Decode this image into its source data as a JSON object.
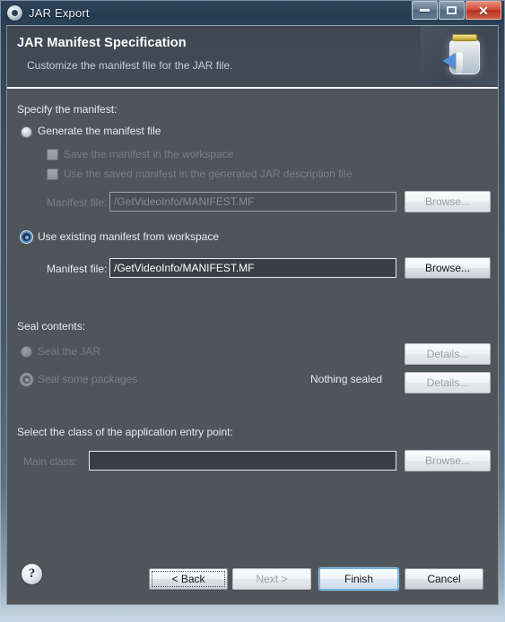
{
  "window": {
    "title": "JAR Export",
    "icon": "gear-icon",
    "controls": {
      "minimize": "minimize-icon",
      "maximize": "maximize-icon",
      "close": "✕"
    }
  },
  "header": {
    "title": "JAR Manifest Specification",
    "subtitle": "Customize the manifest file for the JAR file.",
    "art_icon": "jar-export-icon"
  },
  "content": {
    "manifest_section_label": "Specify the manifest:",
    "generate_radio": {
      "label": "Generate the manifest file",
      "selected": false
    },
    "save_checkbox": {
      "label": "Save the manifest in the workspace",
      "checked": false,
      "enabled": false
    },
    "use_saved_checkbox": {
      "label": "Use the saved manifest in the generated JAR description file",
      "checked": false,
      "enabled": false
    },
    "manifest_file_disabled": {
      "label": "Manifest file:",
      "value": "/GetVideoInfo/MANIFEST.MF",
      "browse_label": "Browse...",
      "enabled": false
    },
    "use_existing_radio": {
      "label": "Use existing manifest from workspace",
      "selected": true
    },
    "manifest_file_enabled": {
      "label": "Manifest file:",
      "value": "/GetVideoInfo/MANIFEST.MF",
      "browse_label": "Browse...",
      "enabled": true
    },
    "seal_section_label": "Seal contents:",
    "seal_jar_radio": {
      "label": "Seal the JAR",
      "selected": false,
      "details_label": "Details..."
    },
    "seal_packages_radio": {
      "label": "Seal some packages",
      "selected": true,
      "status": "Nothing sealed",
      "details_label": "Details..."
    },
    "entry_point_label": "Select the class of the application entry point:",
    "main_class": {
      "label": "Main class:",
      "value": "",
      "placeholder": "",
      "browse_label": "Browse..."
    }
  },
  "buttons": {
    "help": "?",
    "back": "< Back",
    "next": "Next >",
    "finish": "Finish",
    "cancel": "Cancel"
  },
  "colors": {
    "body_bg": "#50555a",
    "header_bg": "#414a54",
    "titlebar_bg": "#2b3f55",
    "accent_blue": "#3f8fd2",
    "close_red": "#b52f1c"
  }
}
